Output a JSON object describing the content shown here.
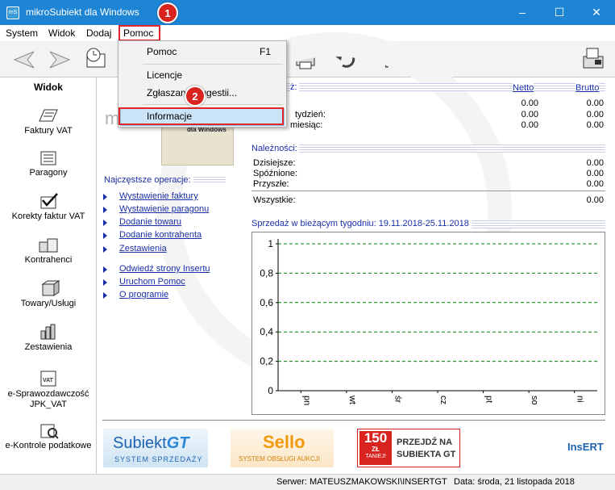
{
  "window": {
    "title": "mikroSubiekt dla Windows",
    "app_icon": "mS"
  },
  "menubar": {
    "items": [
      "System",
      "Widok",
      "Dodaj",
      "Pomoc"
    ]
  },
  "dropdown": {
    "items": [
      {
        "label": "Pomoc",
        "shortcut": "F1"
      },
      {
        "label": "Licencje"
      },
      {
        "label": "Zgłaszanie sugestii..."
      },
      {
        "label": "Informacje"
      }
    ]
  },
  "badges": [
    "1",
    "2"
  ],
  "sidebar": {
    "title": "Widok",
    "items": [
      {
        "label": "Faktury VAT"
      },
      {
        "label": "Paragony"
      },
      {
        "label": "Korekty faktur VAT"
      },
      {
        "label": "Kontrahenci"
      },
      {
        "label": "Towary/Usługi"
      },
      {
        "label": "Zestawienia"
      },
      {
        "label": "e-Sprawozdawczość JPK_VAT"
      },
      {
        "label": "e-Kontrole podatkowe"
      }
    ]
  },
  "logo": {
    "text": "m",
    "caption": "dla Windows"
  },
  "operations": {
    "title": "Najczęstsze operacje:",
    "links": [
      "Wystawienie faktury",
      "Wystawienie paragonu",
      "Dodanie towaru",
      "Dodanie kontrahenta",
      "Zestawienia"
    ],
    "links2": [
      "Odwiedź strony Insertu",
      "Uruchom Pomoc",
      "O programie"
    ]
  },
  "sales": {
    "title_fragment": "ż:",
    "col_netto": "Netto",
    "col_brutto": "Brutto",
    "rows": [
      {
        "label": "",
        "netto": "0.00",
        "brutto": "0.00"
      },
      {
        "label": "tydzień:",
        "netto": "0.00",
        "brutto": "0.00"
      },
      {
        "label": "miesiąc:",
        "netto": "0.00",
        "brutto": "0.00"
      }
    ]
  },
  "receivables": {
    "title": "Należności:",
    "rows": [
      {
        "label": "Dzisiejsze:",
        "value": "0.00"
      },
      {
        "label": "Spóźnione:",
        "value": "0.00"
      },
      {
        "label": "Przyszłe:",
        "value": "0.00"
      }
    ],
    "total_label": "Wszystkie:",
    "total_value": "0.00"
  },
  "chart_title": "Sprzedaż w bieżącym tygodniu: 19.11.2018-25.11.2018",
  "chart_data": {
    "type": "line",
    "title": "Sprzedaż w bieżącym tygodniu: 19.11.2018-25.11.2018",
    "categories": [
      "pn",
      "wt",
      "śr",
      "cz",
      "pt",
      "so",
      "ni"
    ],
    "values": [
      0,
      0,
      0,
      0,
      0,
      0,
      0
    ],
    "ylim": [
      0,
      1
    ],
    "yticks": [
      "0",
      "0,2",
      "0,4",
      "0,6",
      "0,8",
      "1"
    ],
    "grid": true,
    "grid_color": "#008000"
  },
  "banners": {
    "subiekt": {
      "name": "Subiekt",
      "suffix": "GT",
      "tagline": "SYSTEM SPRZEDAŻY"
    },
    "sello": {
      "name": "Sello",
      "tagline": "SYSTEM OBSŁUGI AUKCJI"
    },
    "promo": {
      "price": "150",
      "currency": "ZŁ",
      "note": "TANIEJ!",
      "line1": "PRZEJDŹ NA",
      "line2": "SUBIEKTA GT"
    },
    "insert": "InsERT"
  },
  "status": {
    "server": "Serwer: MATEUSZMAKOWSKI\\INSERTGT",
    "date": "Data: środa, 21 listopada 2018"
  },
  "colors": {
    "titlebar": "#1e84d4",
    "link": "#1a2fa8",
    "accent_red": "#e0262a"
  }
}
